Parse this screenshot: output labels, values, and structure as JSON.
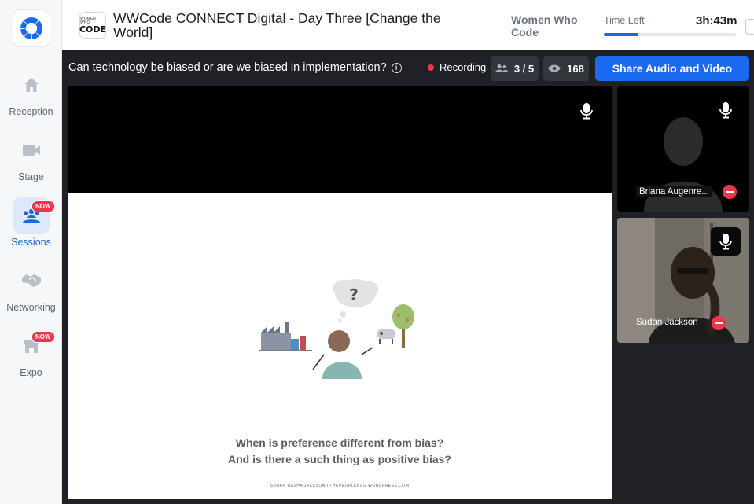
{
  "nav": {
    "items": [
      {
        "label": "Reception",
        "icon": "home-icon",
        "active": false,
        "badge": ""
      },
      {
        "label": "Stage",
        "icon": "video-camera-icon",
        "active": false,
        "badge": ""
      },
      {
        "label": "Sessions",
        "icon": "sessions-group-icon",
        "active": true,
        "badge": "NOW"
      },
      {
        "label": "Networking",
        "icon": "handshake-icon",
        "active": false,
        "badge": ""
      },
      {
        "label": "Expo",
        "icon": "booth-icon",
        "active": false,
        "badge": "NOW"
      }
    ]
  },
  "header": {
    "event_logo_small": "WOMEN WHO",
    "event_logo_big": "CODE",
    "event_title": "WWCode CONNECT Digital - Day Three [Change the World]",
    "organizer": "Women Who Code",
    "time_left_label": "Time Left",
    "time_left_value": "3h:43m",
    "time_progress_fraction": 0.26
  },
  "session": {
    "title": "Can technology be biased or are we biased in implementation?",
    "info_icon": "i",
    "recording_label": "Recording",
    "speakers_count": "3 / 5",
    "viewers_count": "168",
    "share_button_label": "Share Audio and Video"
  },
  "slide": {
    "line1": "When is preference different from bias?",
    "line2": "And is there a such thing as positive bias?",
    "credit": "SUDAN RASHA JACKSON | THEPEOPLEBUG.WORDPRESS.COM",
    "question_mark": "?"
  },
  "participants": [
    {
      "name": "Briana Augenre...",
      "video": "off"
    },
    {
      "name": "Sudan Jackson",
      "video": "on"
    }
  ],
  "colors": {
    "accent": "#1a6af0",
    "recording": "#f0354d",
    "stage_bg": "#1f2126"
  }
}
